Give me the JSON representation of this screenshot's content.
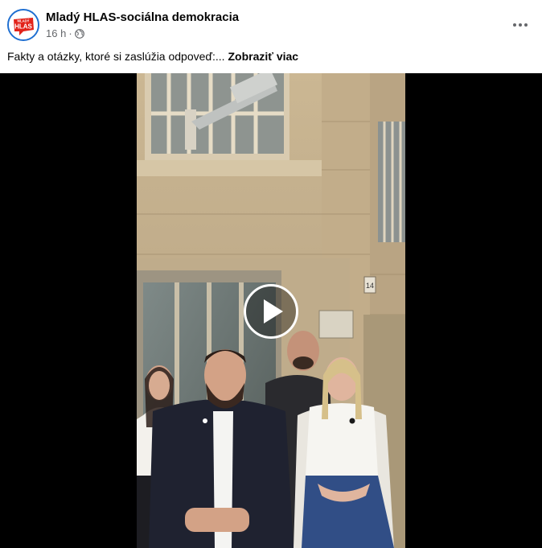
{
  "post": {
    "page_name": "Mladý HLAS-sociálna demokracia",
    "time": "16 h",
    "separator": "·",
    "privacy_icon": "globe-icon",
    "more_icon": "more-horizontal-icon",
    "caption_text": "Fakty a otázky, ktoré si zaslúžia odpoveď:...",
    "see_more_label": "Zobraziť viac",
    "avatar_logo": {
      "line1": "MLADÝ",
      "line2": "HLAS"
    },
    "building_number": "14"
  },
  "video": {
    "play_icon": "play-icon"
  },
  "colors": {
    "brand_red": "#e2231a",
    "brand_blue": "#1f6fd1",
    "text_primary": "#050505",
    "text_secondary": "#65676b",
    "video_background": "#000000"
  }
}
